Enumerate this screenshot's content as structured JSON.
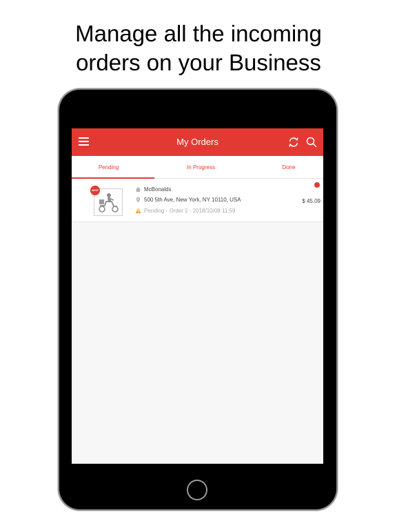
{
  "headline": {
    "line1": "Manage all the incoming",
    "line2": "orders on your Business"
  },
  "app": {
    "title": "My Orders",
    "icons": {
      "menu": "hamburger-menu-icon",
      "refresh": "refresh-icon",
      "search": "search-icon"
    }
  },
  "tabs": [
    {
      "label": "Pending",
      "active": true
    },
    {
      "label": "In Progress",
      "active": false
    },
    {
      "label": "Done",
      "active": false
    }
  ],
  "orders": [
    {
      "badge": "NEW",
      "business": "McBonalds",
      "address": "500 5th Ave, New York, NY 10110, USA",
      "status": "Pending - Order 2 - 2018/10/08 11:59",
      "price": "$ 45.09",
      "unread": true
    }
  ],
  "colors": {
    "accent": "#e23a33",
    "warning": "#e8a92d"
  }
}
